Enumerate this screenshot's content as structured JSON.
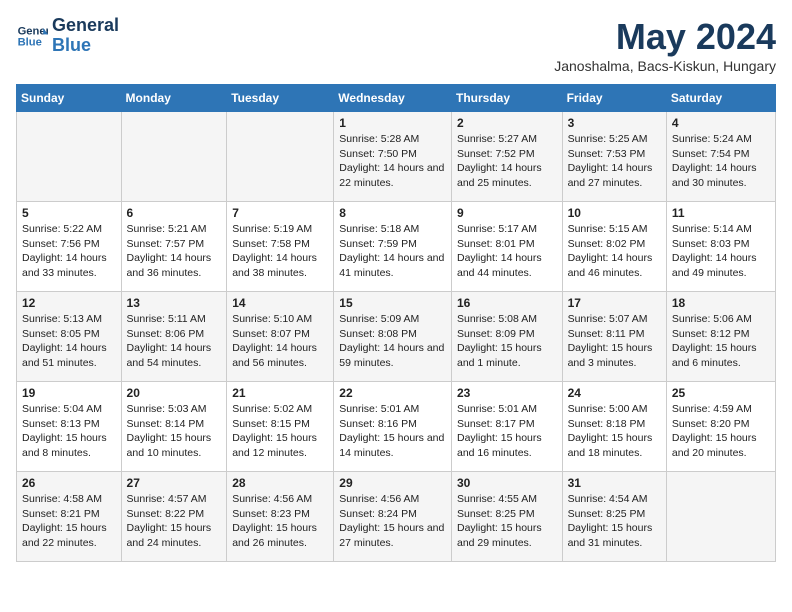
{
  "header": {
    "logo_line1": "General",
    "logo_line2": "Blue",
    "month": "May 2024",
    "location": "Janoshalma, Bacs-Kiskun, Hungary"
  },
  "weekdays": [
    "Sunday",
    "Monday",
    "Tuesday",
    "Wednesday",
    "Thursday",
    "Friday",
    "Saturday"
  ],
  "weeks": [
    [
      {
        "day": "",
        "info": ""
      },
      {
        "day": "",
        "info": ""
      },
      {
        "day": "",
        "info": ""
      },
      {
        "day": "1",
        "info": "Sunrise: 5:28 AM\nSunset: 7:50 PM\nDaylight: 14 hours and 22 minutes."
      },
      {
        "day": "2",
        "info": "Sunrise: 5:27 AM\nSunset: 7:52 PM\nDaylight: 14 hours and 25 minutes."
      },
      {
        "day": "3",
        "info": "Sunrise: 5:25 AM\nSunset: 7:53 PM\nDaylight: 14 hours and 27 minutes."
      },
      {
        "day": "4",
        "info": "Sunrise: 5:24 AM\nSunset: 7:54 PM\nDaylight: 14 hours and 30 minutes."
      }
    ],
    [
      {
        "day": "5",
        "info": "Sunrise: 5:22 AM\nSunset: 7:56 PM\nDaylight: 14 hours and 33 minutes."
      },
      {
        "day": "6",
        "info": "Sunrise: 5:21 AM\nSunset: 7:57 PM\nDaylight: 14 hours and 36 minutes."
      },
      {
        "day": "7",
        "info": "Sunrise: 5:19 AM\nSunset: 7:58 PM\nDaylight: 14 hours and 38 minutes."
      },
      {
        "day": "8",
        "info": "Sunrise: 5:18 AM\nSunset: 7:59 PM\nDaylight: 14 hours and 41 minutes."
      },
      {
        "day": "9",
        "info": "Sunrise: 5:17 AM\nSunset: 8:01 PM\nDaylight: 14 hours and 44 minutes."
      },
      {
        "day": "10",
        "info": "Sunrise: 5:15 AM\nSunset: 8:02 PM\nDaylight: 14 hours and 46 minutes."
      },
      {
        "day": "11",
        "info": "Sunrise: 5:14 AM\nSunset: 8:03 PM\nDaylight: 14 hours and 49 minutes."
      }
    ],
    [
      {
        "day": "12",
        "info": "Sunrise: 5:13 AM\nSunset: 8:05 PM\nDaylight: 14 hours and 51 minutes."
      },
      {
        "day": "13",
        "info": "Sunrise: 5:11 AM\nSunset: 8:06 PM\nDaylight: 14 hours and 54 minutes."
      },
      {
        "day": "14",
        "info": "Sunrise: 5:10 AM\nSunset: 8:07 PM\nDaylight: 14 hours and 56 minutes."
      },
      {
        "day": "15",
        "info": "Sunrise: 5:09 AM\nSunset: 8:08 PM\nDaylight: 14 hours and 59 minutes."
      },
      {
        "day": "16",
        "info": "Sunrise: 5:08 AM\nSunset: 8:09 PM\nDaylight: 15 hours and 1 minute."
      },
      {
        "day": "17",
        "info": "Sunrise: 5:07 AM\nSunset: 8:11 PM\nDaylight: 15 hours and 3 minutes."
      },
      {
        "day": "18",
        "info": "Sunrise: 5:06 AM\nSunset: 8:12 PM\nDaylight: 15 hours and 6 minutes."
      }
    ],
    [
      {
        "day": "19",
        "info": "Sunrise: 5:04 AM\nSunset: 8:13 PM\nDaylight: 15 hours and 8 minutes."
      },
      {
        "day": "20",
        "info": "Sunrise: 5:03 AM\nSunset: 8:14 PM\nDaylight: 15 hours and 10 minutes."
      },
      {
        "day": "21",
        "info": "Sunrise: 5:02 AM\nSunset: 8:15 PM\nDaylight: 15 hours and 12 minutes."
      },
      {
        "day": "22",
        "info": "Sunrise: 5:01 AM\nSunset: 8:16 PM\nDaylight: 15 hours and 14 minutes."
      },
      {
        "day": "23",
        "info": "Sunrise: 5:01 AM\nSunset: 8:17 PM\nDaylight: 15 hours and 16 minutes."
      },
      {
        "day": "24",
        "info": "Sunrise: 5:00 AM\nSunset: 8:18 PM\nDaylight: 15 hours and 18 minutes."
      },
      {
        "day": "25",
        "info": "Sunrise: 4:59 AM\nSunset: 8:20 PM\nDaylight: 15 hours and 20 minutes."
      }
    ],
    [
      {
        "day": "26",
        "info": "Sunrise: 4:58 AM\nSunset: 8:21 PM\nDaylight: 15 hours and 22 minutes."
      },
      {
        "day": "27",
        "info": "Sunrise: 4:57 AM\nSunset: 8:22 PM\nDaylight: 15 hours and 24 minutes."
      },
      {
        "day": "28",
        "info": "Sunrise: 4:56 AM\nSunset: 8:23 PM\nDaylight: 15 hours and 26 minutes."
      },
      {
        "day": "29",
        "info": "Sunrise: 4:56 AM\nSunset: 8:24 PM\nDaylight: 15 hours and 27 minutes."
      },
      {
        "day": "30",
        "info": "Sunrise: 4:55 AM\nSunset: 8:25 PM\nDaylight: 15 hours and 29 minutes."
      },
      {
        "day": "31",
        "info": "Sunrise: 4:54 AM\nSunset: 8:25 PM\nDaylight: 15 hours and 31 minutes."
      },
      {
        "day": "",
        "info": ""
      }
    ]
  ]
}
